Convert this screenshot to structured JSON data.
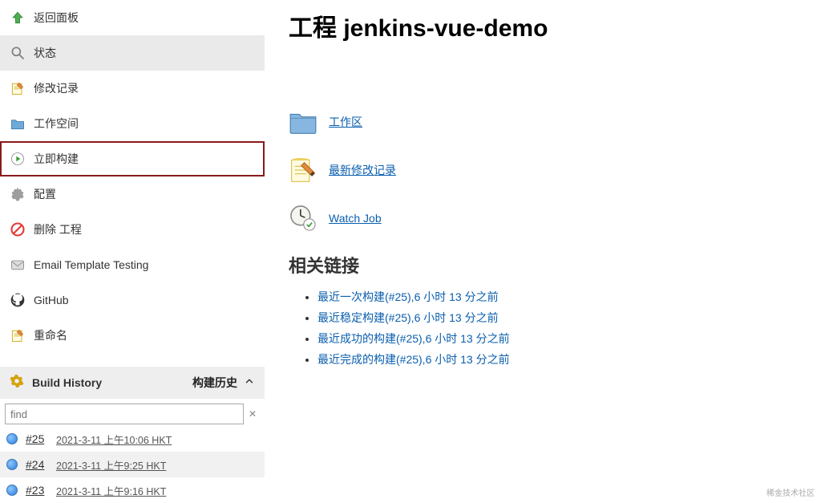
{
  "page": {
    "title": "工程 jenkins-vue-demo"
  },
  "sidebar": {
    "items": [
      {
        "label": "返回面板",
        "icon": "arrow-up"
      },
      {
        "label": "状态",
        "icon": "search",
        "current": true
      },
      {
        "label": "修改记录",
        "icon": "notepad"
      },
      {
        "label": "工作空间",
        "icon": "folder"
      },
      {
        "label": "立即构建",
        "icon": "play",
        "highlight": true
      },
      {
        "label": "配置",
        "icon": "gear"
      },
      {
        "label": "删除 工程",
        "icon": "forbid"
      },
      {
        "label": "Email Template Testing",
        "icon": "mail"
      },
      {
        "label": "GitHub",
        "icon": "github"
      },
      {
        "label": "重命名",
        "icon": "notepad"
      }
    ]
  },
  "buildHistory": {
    "title": "Build History",
    "subtitle": "构建历史",
    "searchPlaceholder": "find",
    "entries": [
      {
        "num": "#25",
        "time": "2021-3-11 上午10:06 HKT"
      },
      {
        "num": "#24",
        "time": "2021-3-11 上午9:25 HKT"
      },
      {
        "num": "#23",
        "time": "2021-3-11 上午9:16 HKT"
      }
    ]
  },
  "mainLinks": [
    {
      "label": "工作区",
      "icon": "folder-big"
    },
    {
      "label": "最新修改记录",
      "icon": "notepad-big"
    },
    {
      "label": "Watch Job",
      "icon": "clock-big"
    }
  ],
  "related": {
    "heading": "相关链接",
    "items": [
      "最近一次构建(#25),6 小时 13 分之前",
      "最近稳定构建(#25),6 小时 13 分之前",
      "最近成功的构建(#25),6 小时 13 分之前",
      "最近完成的构建(#25),6 小时 13 分之前"
    ]
  },
  "watermark": "稀金技术社区"
}
